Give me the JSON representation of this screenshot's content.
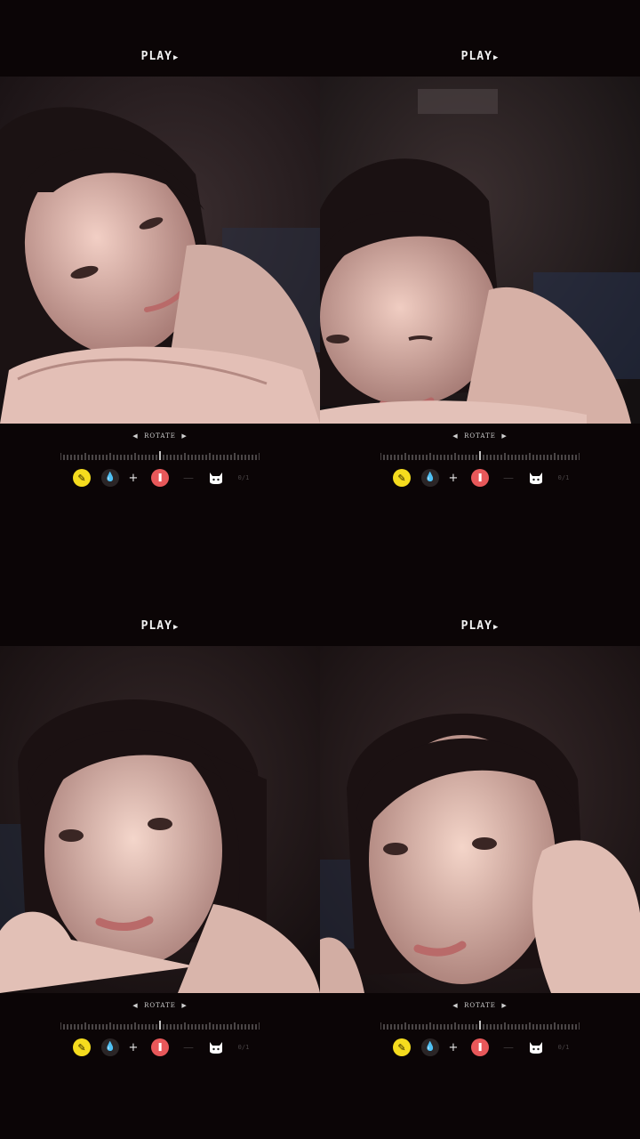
{
  "frames": [
    {
      "play_label": "PLAY",
      "rotate_label": "ROTATE",
      "aux_label": "0/1"
    },
    {
      "play_label": "PLAY",
      "rotate_label": "ROTATE",
      "aux_label": "0/1"
    },
    {
      "play_label": "PLAY",
      "rotate_label": "ROTATE",
      "aux_label": "0/1"
    },
    {
      "play_label": "PLAY",
      "rotate_label": "ROTATE",
      "aux_label": "0/1"
    }
  ],
  "colors": {
    "background": "#0b0506",
    "pencil_button": "#f5dc1e",
    "record_button": "#e8585a",
    "drop_button": "#2a2526",
    "label_text": "#f2f2f2"
  },
  "icons": [
    "play-triangle-icon",
    "chevron-left-icon",
    "chevron-right-icon",
    "pencil-icon",
    "drop-icon",
    "plus-icon",
    "record-icon",
    "minus-icon",
    "cat-icon"
  ]
}
